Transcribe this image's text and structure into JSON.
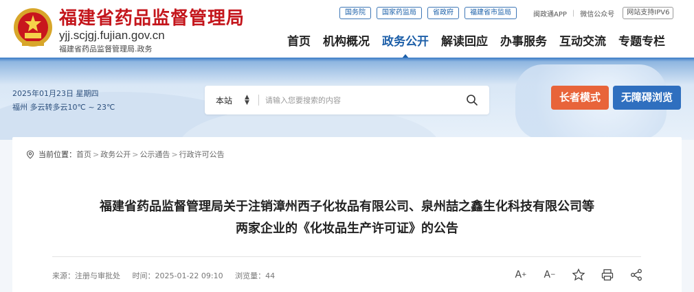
{
  "header": {
    "site_title": "福建省药品监督管理局",
    "domain": "yjj.scjgj.fujian.gov.cn",
    "subtitle": "福建省药品监督管理局.政务",
    "top_links": [
      "国务院",
      "国家药监局",
      "省政府",
      "福建省市监局"
    ],
    "app_link": "闽政通APP",
    "wechat_link": "微信公众号",
    "ipv6_badge": "网站支持IPV6",
    "nav": [
      {
        "label": "首页",
        "active": false
      },
      {
        "label": "机构概况",
        "active": false
      },
      {
        "label": "政务公开",
        "active": true
      },
      {
        "label": "解读回应",
        "active": false
      },
      {
        "label": "办事服务",
        "active": false
      },
      {
        "label": "互动交流",
        "active": false
      },
      {
        "label": "专题专栏",
        "active": false
      }
    ]
  },
  "banner": {
    "date": "2025年01月23日 星期四",
    "weather": "福州 多云转多云10℃ ~ 23℃",
    "search_scope": "本站",
    "search_placeholder": "请输入您要搜索的内容",
    "elder_mode": "长者模式",
    "accessible": "无障碍浏览"
  },
  "breadcrumb": {
    "label": "当前位置：",
    "items": [
      "首页",
      "政务公开",
      "公示通告",
      "行政许可公告"
    ]
  },
  "article": {
    "title_line1": "福建省药品监督管理局关于注销漳州西子化妆品有限公司、泉州喆之鑫生化科技有限公司等",
    "title_line2": "两家企业的《化妆品生产许可证》的公告",
    "source": "来源：注册与审批处",
    "time": "时间：2025-01-22 09:10",
    "views": "浏览量：44"
  },
  "colors": {
    "brand_red": "#c4161c",
    "nav_active": "#1d5fa8",
    "elder_btn": "#e8643a",
    "access_btn": "#2f6fbf"
  },
  "icons": [
    "emblem-icon",
    "search-icon",
    "location-icon",
    "font-increase-icon",
    "font-decrease-icon",
    "star-icon",
    "print-icon",
    "share-icon"
  ]
}
